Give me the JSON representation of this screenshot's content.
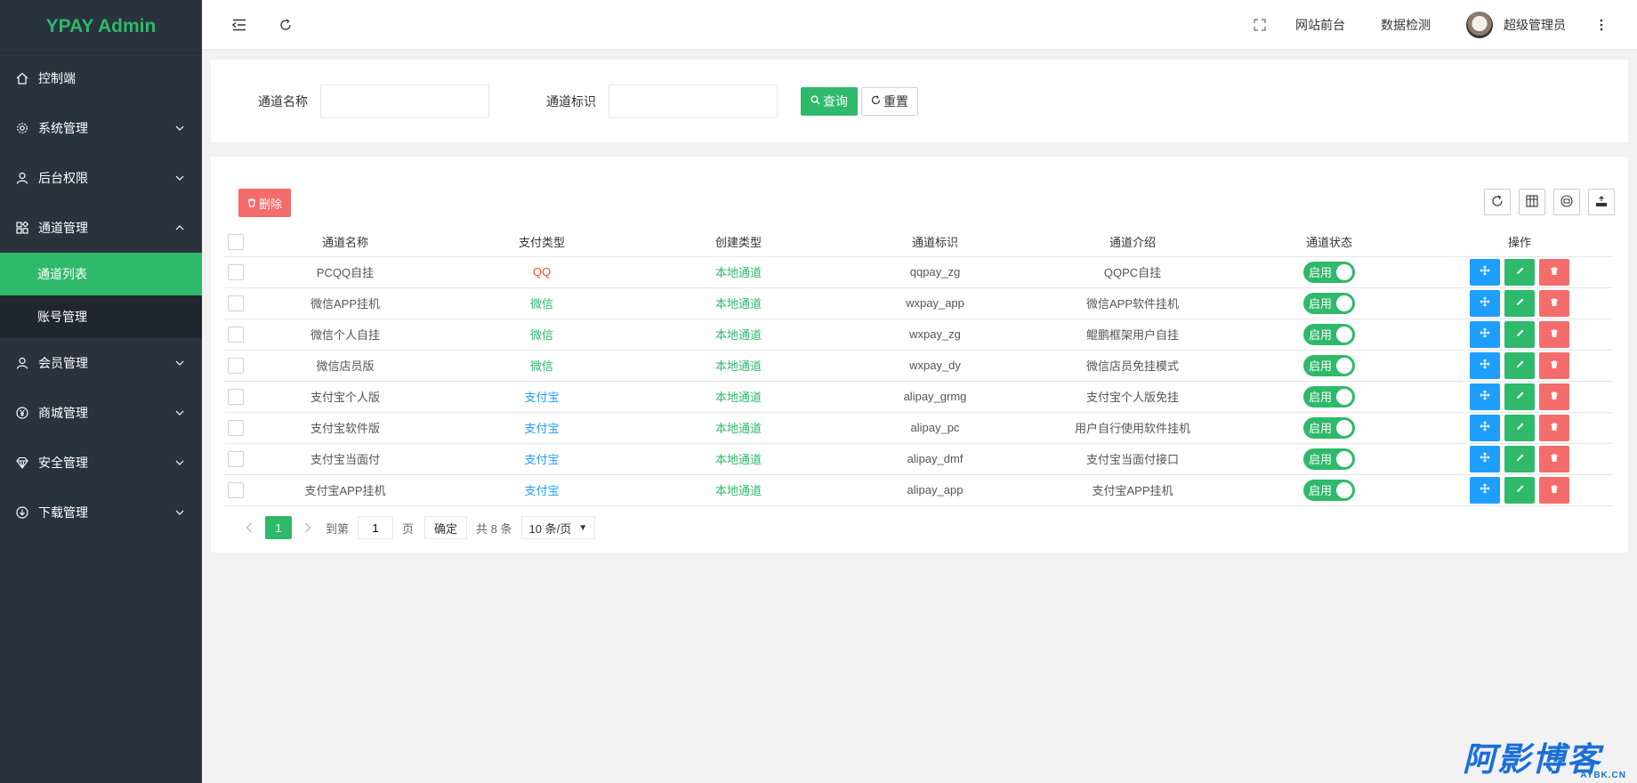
{
  "sidebar": {
    "logo": "YPAY Admin",
    "items": [
      {
        "label": "控制端"
      },
      {
        "label": "系统管理"
      },
      {
        "label": "后台权限"
      },
      {
        "label": "通道管理"
      },
      {
        "label": "会员管理"
      },
      {
        "label": "商城管理"
      },
      {
        "label": "安全管理"
      },
      {
        "label": "下载管理"
      }
    ],
    "sub_items": [
      {
        "label": "通道列表",
        "active": true
      },
      {
        "label": "账号管理",
        "active": false
      }
    ]
  },
  "header": {
    "links": [
      "网站前台",
      "数据检测"
    ],
    "user_name": "超级管理员"
  },
  "search": {
    "channel_name_label": "通道名称",
    "channel_name_value": "",
    "channel_id_label": "通道标识",
    "channel_id_value": "",
    "query_label": "查询",
    "reset_label": "重置"
  },
  "table": {
    "delete_label": "删除",
    "columns": [
      "通道名称",
      "支付类型",
      "创建类型",
      "通道标识",
      "通道介绍",
      "通道状态",
      "操作"
    ],
    "rows": [
      {
        "name": "PCQQ自挂",
        "pay_type": "QQ",
        "pay_color": "#f54f1b",
        "create_type": "本地通道",
        "code": "qqpay_zg",
        "intro": "QQPC自挂",
        "status": "启用"
      },
      {
        "name": "微信APP挂机",
        "pay_type": "微信",
        "pay_color": "#2fb96a",
        "create_type": "本地通道",
        "code": "wxpay_app",
        "intro": "微信APP软件挂机",
        "status": "启用"
      },
      {
        "name": "微信个人自挂",
        "pay_type": "微信",
        "pay_color": "#2fb96a",
        "create_type": "本地通道",
        "code": "wxpay_zg",
        "intro": "鲲鹏框架用户自挂",
        "status": "启用"
      },
      {
        "name": "微信店员版",
        "pay_type": "微信",
        "pay_color": "#2fb96a",
        "create_type": "本地通道",
        "code": "wxpay_dy",
        "intro": "微信店员免挂模式",
        "status": "启用"
      },
      {
        "name": "支付宝个人版",
        "pay_type": "支付宝",
        "pay_color": "#1e9fff",
        "create_type": "本地通道",
        "code": "alipay_grmg",
        "intro": "支付宝个人版免挂",
        "status": "启用"
      },
      {
        "name": "支付宝软件版",
        "pay_type": "支付宝",
        "pay_color": "#1e9fff",
        "create_type": "本地通道",
        "code": "alipay_pc",
        "intro": "用户自行使用软件挂机",
        "status": "启用"
      },
      {
        "name": "支付宝当面付",
        "pay_type": "支付宝",
        "pay_color": "#1e9fff",
        "create_type": "本地通道",
        "code": "alipay_dmf",
        "intro": "支付宝当面付接口",
        "status": "启用"
      },
      {
        "name": "支付宝APP挂机",
        "pay_type": "支付宝",
        "pay_color": "#1e9fff",
        "create_type": "本地通道",
        "code": "alipay_app",
        "intro": "支付宝APP挂机",
        "status": "启用"
      }
    ]
  },
  "pagination": {
    "current_page": "1",
    "goto_label": "到第",
    "goto_value": "1",
    "page_label": "页",
    "confirm_label": "确定",
    "total_label": "共 8 条",
    "page_size": "10 条/页"
  },
  "watermark": {
    "main": "阿影博客",
    "sub": "AYBK.CN"
  },
  "colors": {
    "brand_green": "#2fb96a",
    "sidebar_bg": "#28333e",
    "danger": "#f56c6c",
    "info_blue": "#1e9fff"
  }
}
